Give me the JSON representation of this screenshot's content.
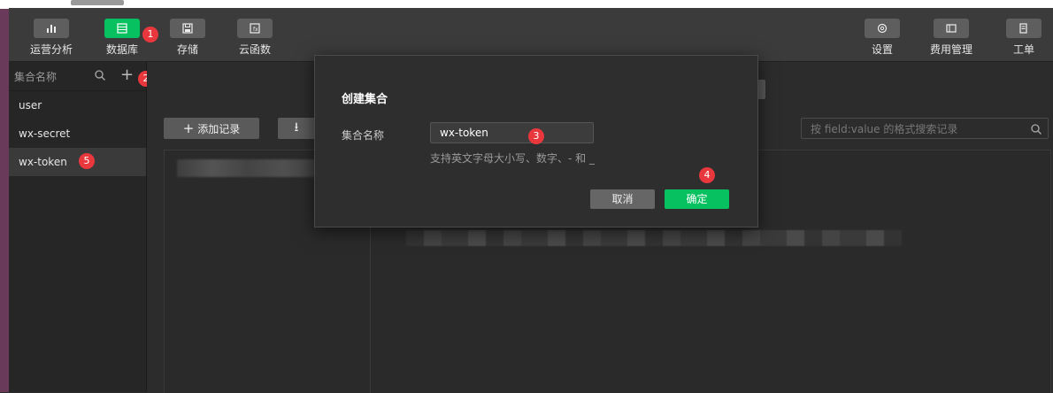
{
  "toolbar": {
    "left": [
      {
        "label": "运营分析",
        "icon": "bar-chart-icon"
      },
      {
        "label": "数据库",
        "icon": "database-icon",
        "active": true
      },
      {
        "label": "存储",
        "icon": "storage-icon"
      },
      {
        "label": "云函数",
        "icon": "cloud-function-icon"
      }
    ],
    "right": [
      {
        "label": "设置",
        "icon": "gear-icon"
      },
      {
        "label": "费用管理",
        "icon": "billing-icon"
      },
      {
        "label": "工单",
        "icon": "ticket-icon"
      }
    ]
  },
  "sidebar": {
    "header": "集合名称",
    "items": [
      {
        "label": "user"
      },
      {
        "label": "wx-secret"
      },
      {
        "label": "wx-token"
      }
    ]
  },
  "main": {
    "add_record": "添加记录",
    "search_placeholder": "按 field:value 的格式搜索记录"
  },
  "modal": {
    "title": "创建集合",
    "field_label": "集合名称",
    "field_value": "wx-token",
    "hint": "支持英文字母大小写、数字、- 和 _",
    "cancel": "取消",
    "confirm": "确定"
  },
  "annotations": [
    "1",
    "2",
    "3",
    "4",
    "5"
  ],
  "colors": {
    "accent": "#07c160",
    "badge": "#e8383d",
    "toolbar": "#3b3b3b",
    "sidebar": "#262626"
  }
}
